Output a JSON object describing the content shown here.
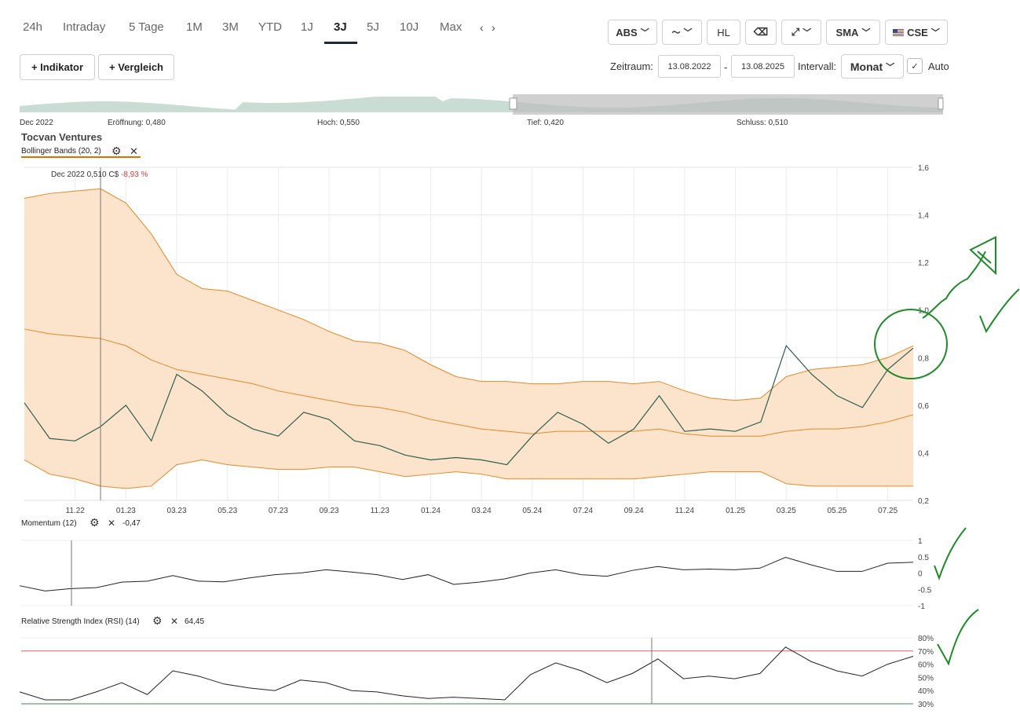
{
  "timeframes": [
    {
      "label": "24h",
      "left": 29
    },
    {
      "label": "Intraday",
      "left": 80
    },
    {
      "label": "5 Tage",
      "left": 164
    },
    {
      "label": "1M",
      "left": 237
    },
    {
      "label": "3M",
      "left": 283
    },
    {
      "label": "YTD",
      "left": 329
    },
    {
      "label": "1J",
      "left": 383
    },
    {
      "label": "3J",
      "left": 425,
      "active": true
    },
    {
      "label": "5J",
      "left": 467
    },
    {
      "label": "10J",
      "left": 509
    },
    {
      "label": "Max",
      "left": 560
    }
  ],
  "toolbar": {
    "abs_label": "ABS",
    "hl_label": "HL",
    "sma_label": "SMA",
    "exchange_label": "CSE"
  },
  "actions": {
    "indicator": "+ Indikator",
    "compare": "+ Vergleich"
  },
  "range": {
    "zeitraum_label": "Zeitraum:",
    "from": "13.08.2022",
    "dash": "-",
    "to": "13.08.2025",
    "interval_label": "Intervall:",
    "interval_value": "Monat",
    "auto_label": "Auto"
  },
  "ohlc": {
    "period": "Dec 2022",
    "open": "Eröffnung: 0,480",
    "high": "Hoch: 0,550",
    "low": "Tief: 0,420",
    "close": "Schluss: 0,510"
  },
  "instrument": {
    "name": "Tocvan Ventures"
  },
  "bollinger": {
    "label": "Bollinger Bands (20, 2)"
  },
  "tooltip": {
    "date": "Dec 2022",
    "value": "0,510 C$",
    "change": "-8,93 %"
  },
  "momentum": {
    "label": "Momentum (12)",
    "value": "-0,47",
    "ticks": [
      "1",
      "0.5",
      "0",
      "-0.5",
      "-1"
    ]
  },
  "rsi": {
    "label": "Relative Strength Index (RSI) (14)",
    "value": "64,45",
    "ticks": [
      "80%",
      "70%",
      "60%",
      "50%",
      "40%",
      "30%"
    ]
  },
  "colors": {
    "band_fill": "#fbe3cc",
    "band_line": "#e08a2a",
    "price_line": "#2f5e4e",
    "accent": "#e07000",
    "rsi_over": "#e06060",
    "annotation": "#1f8a2a"
  },
  "chart_data": {
    "type": "line",
    "title": "Tocvan Ventures",
    "x": [
      "09.22",
      "10.22",
      "11.22",
      "12.22",
      "01.23",
      "02.23",
      "03.23",
      "04.23",
      "05.23",
      "06.23",
      "07.23",
      "08.23",
      "09.23",
      "10.23",
      "11.23",
      "12.23",
      "01.24",
      "02.24",
      "03.24",
      "04.24",
      "05.24",
      "06.24",
      "07.24",
      "08.24",
      "09.24",
      "10.24",
      "11.24",
      "12.24",
      "01.25",
      "02.25",
      "03.25",
      "04.25",
      "05.25",
      "06.25",
      "07.25",
      "08.25"
    ],
    "xticks": [
      "11.22",
      "01.23",
      "03.23",
      "05.23",
      "07.23",
      "09.23",
      "11.23",
      "01.24",
      "03.24",
      "05.24",
      "07.24",
      "09.24",
      "11.24",
      "01.25",
      "03.25",
      "05.25",
      "07.25"
    ],
    "yticks": [
      "1,6",
      "1,4",
      "1,2",
      "1,0",
      "0,8",
      "0,6",
      "0,4",
      "0,2"
    ],
    "ylim": [
      0.2,
      1.6
    ],
    "series": [
      {
        "role": "price",
        "values": [
          0.61,
          0.46,
          0.45,
          0.51,
          0.6,
          0.45,
          0.73,
          0.66,
          0.56,
          0.5,
          0.47,
          0.57,
          0.54,
          0.45,
          0.43,
          0.39,
          0.37,
          0.38,
          0.37,
          0.35,
          0.47,
          0.57,
          0.52,
          0.44,
          0.5,
          0.64,
          0.49,
          0.5,
          0.49,
          0.53,
          0.85,
          0.73,
          0.64,
          0.59,
          0.75,
          0.84
        ]
      },
      {
        "role": "upper",
        "values": [
          1.47,
          1.49,
          1.5,
          1.51,
          1.45,
          1.32,
          1.15,
          1.09,
          1.08,
          1.04,
          1.0,
          0.96,
          0.91,
          0.87,
          0.86,
          0.83,
          0.77,
          0.72,
          0.7,
          0.7,
          0.69,
          0.69,
          0.7,
          0.7,
          0.69,
          0.7,
          0.66,
          0.63,
          0.62,
          0.63,
          0.72,
          0.75,
          0.76,
          0.77,
          0.8,
          0.85
        ]
      },
      {
        "role": "middle",
        "values": [
          0.92,
          0.9,
          0.89,
          0.88,
          0.85,
          0.79,
          0.75,
          0.73,
          0.71,
          0.69,
          0.66,
          0.64,
          0.62,
          0.6,
          0.59,
          0.57,
          0.54,
          0.52,
          0.5,
          0.49,
          0.48,
          0.49,
          0.49,
          0.49,
          0.49,
          0.5,
          0.48,
          0.47,
          0.47,
          0.47,
          0.49,
          0.5,
          0.5,
          0.51,
          0.53,
          0.56
        ]
      },
      {
        "role": "lower",
        "values": [
          0.37,
          0.31,
          0.29,
          0.26,
          0.25,
          0.26,
          0.35,
          0.37,
          0.35,
          0.34,
          0.33,
          0.33,
          0.34,
          0.34,
          0.32,
          0.3,
          0.31,
          0.32,
          0.31,
          0.29,
          0.29,
          0.29,
          0.29,
          0.29,
          0.29,
          0.3,
          0.31,
          0.32,
          0.32,
          0.32,
          0.27,
          0.26,
          0.26,
          0.26,
          0.26,
          0.26
        ]
      }
    ],
    "momentum_values": [
      -0.39,
      -0.55,
      -0.48,
      -0.45,
      -0.28,
      -0.25,
      -0.08,
      -0.25,
      -0.27,
      -0.15,
      -0.05,
      0.0,
      0.1,
      0.03,
      -0.05,
      -0.2,
      -0.05,
      -0.35,
      -0.28,
      -0.18,
      0.0,
      0.1,
      -0.05,
      -0.1,
      0.08,
      0.2,
      0.1,
      0.12,
      0.1,
      0.15,
      0.48,
      0.25,
      0.05,
      0.05,
      0.3,
      0.33
    ],
    "rsi_values": [
      39,
      33,
      33,
      39,
      46,
      37,
      55,
      51,
      45,
      42,
      40,
      48,
      46,
      40,
      39,
      36,
      34,
      35,
      34,
      33,
      52,
      61,
      55,
      46,
      53,
      64,
      49,
      51,
      49,
      53,
      73,
      62,
      55,
      51,
      60,
      66
    ]
  }
}
